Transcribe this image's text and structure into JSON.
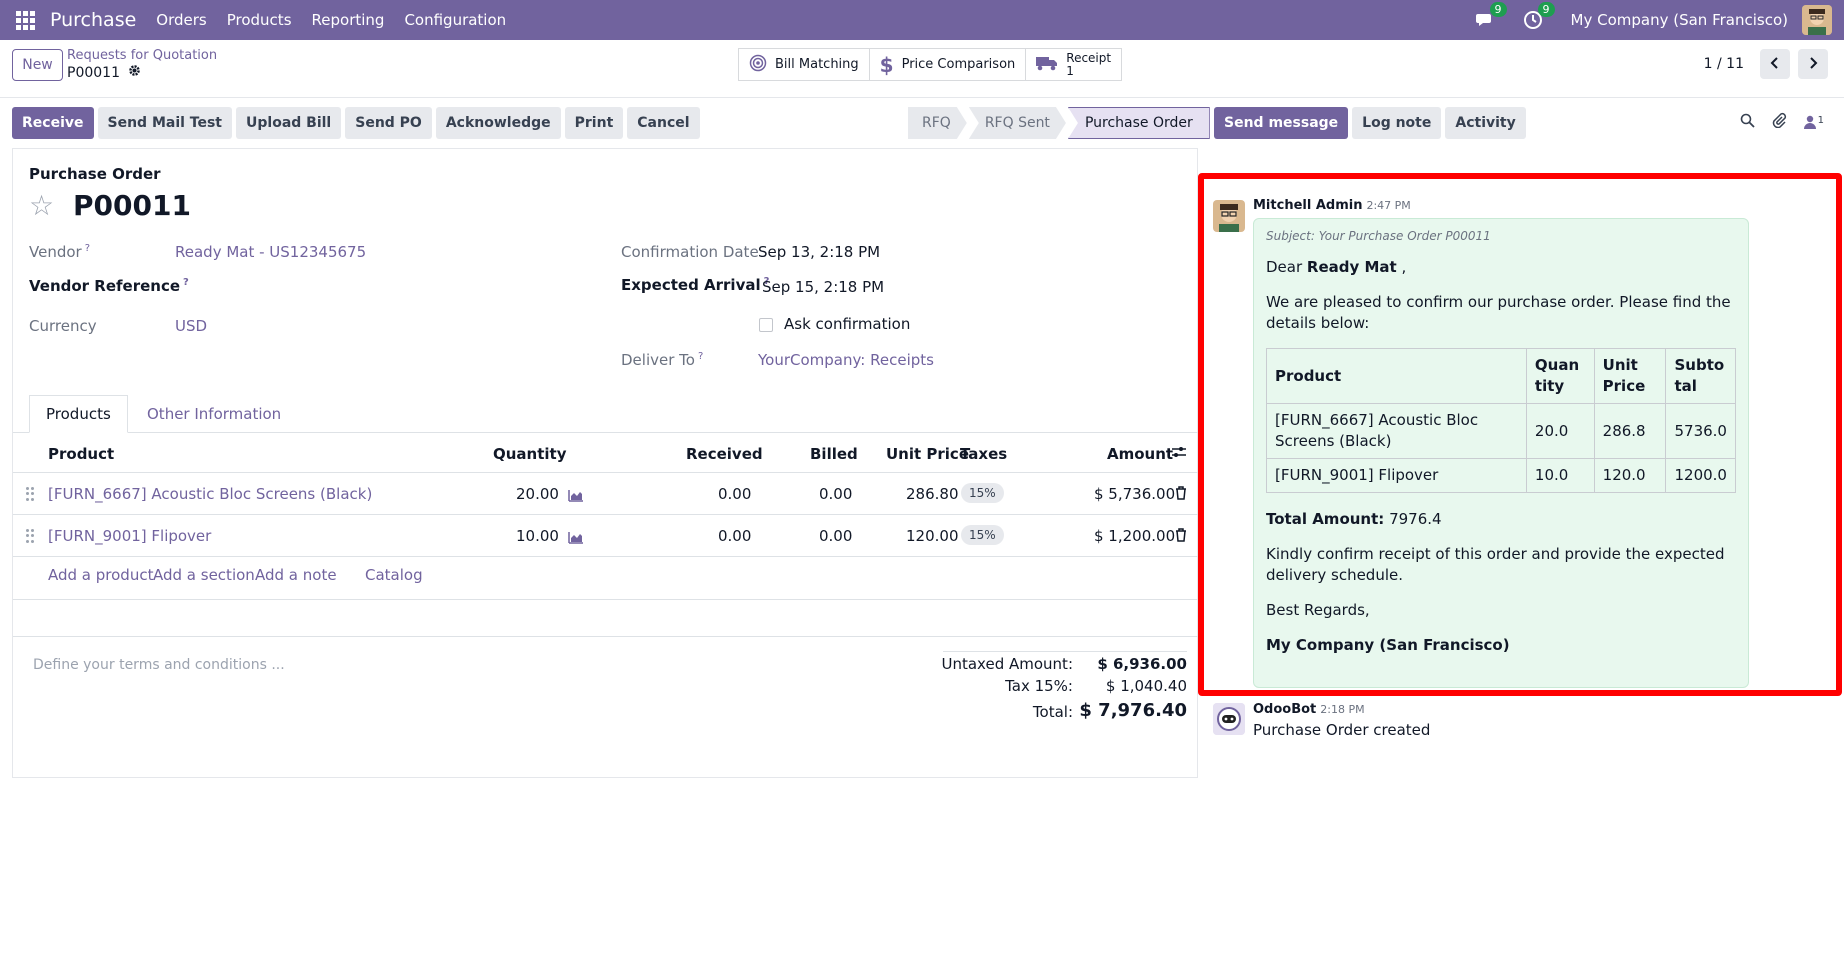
{
  "navbar": {
    "app_name": "Purchase",
    "menu": [
      "Orders",
      "Products",
      "Reporting",
      "Configuration"
    ],
    "messages_badge": "9",
    "activities_badge": "9",
    "company": "My Company (San Francisco)"
  },
  "control": {
    "new_label": "New",
    "breadcrumb_parent": "Requests for Quotation",
    "record_name": "P00011",
    "smart_buttons": {
      "bill_matching": "Bill Matching",
      "price_comparison": "Price Comparison",
      "receipt_label": "Receipt",
      "receipt_count": "1"
    },
    "pager": "1 / 11"
  },
  "actions": [
    "Receive",
    "Send Mail Test",
    "Upload Bill",
    "Send PO",
    "Acknowledge",
    "Print",
    "Cancel"
  ],
  "stages": [
    "RFQ",
    "RFQ Sent",
    "Purchase Order"
  ],
  "form": {
    "label": "Purchase Order",
    "name": "P00011",
    "vendor_label": "Vendor",
    "vendor_value": "Ready Mat - US12345675",
    "vendor_ref_label": "Vendor Reference",
    "currency_label": "Currency",
    "currency_value": "USD",
    "confirmation_label": "Confirmation Date",
    "confirmation_value": "Sep 13, 2:18 PM",
    "arrival_label": "Expected Arrival",
    "arrival_value": "Sep 15, 2:18 PM",
    "ask_confirmation": "Ask confirmation",
    "deliver_label": "Deliver To",
    "deliver_value": "YourCompany: Receipts",
    "help_mark": "?"
  },
  "tabs": [
    "Products",
    "Other Information"
  ],
  "lines": {
    "headers": {
      "product": "Product",
      "quantity": "Quantity",
      "received": "Received",
      "billed": "Billed",
      "unit_price": "Unit Price",
      "taxes": "Taxes",
      "amount": "Amount"
    },
    "rows": [
      {
        "product": "[FURN_6667] Acoustic Bloc Screens (Black)",
        "quantity": "20.00",
        "received": "0.00",
        "billed": "0.00",
        "unit_price": "286.80",
        "tax": "15%",
        "amount": "$ 5,736.00"
      },
      {
        "product": "[FURN_9001] Flipover",
        "quantity": "10.00",
        "received": "0.00",
        "billed": "0.00",
        "unit_price": "120.00",
        "tax": "15%",
        "amount": "$ 1,200.00"
      }
    ],
    "add_product": "Add a product",
    "add_section": "Add a section",
    "add_note": "Add a note",
    "catalog": "Catalog"
  },
  "terms_placeholder": "Define your terms and conditions ...",
  "totals": {
    "untaxed_label": "Untaxed Amount:",
    "untaxed_value": "$ 6,936.00",
    "tax_label": "Tax 15%:",
    "tax_value": "$ 1,040.40",
    "total_label": "Total:",
    "total_value": "$ 7,976.40"
  },
  "chatter": {
    "send_message": "Send message",
    "log_note": "Log note",
    "activity": "Activity",
    "followers_count": "1",
    "message1": {
      "author": "Mitchell Admin",
      "time": "2:47 PM",
      "subject": "Subject: Your Purchase Order P00011",
      "greeting_prefix": "Dear",
      "greeting_name": "Ready Mat",
      "greeting_suffix": ",",
      "intro": "We are pleased to confirm our purchase order. Please find the details below:",
      "table_headers": [
        "Product",
        "Quantity",
        "Unit Price",
        "Subtotal"
      ],
      "table_rows": [
        [
          "[FURN_6667] Acoustic Bloc Screens (Black)",
          "20.0",
          "286.8",
          "5736.0"
        ],
        [
          "[FURN_9001] Flipover",
          "10.0",
          "120.0",
          "1200.0"
        ]
      ],
      "total_label": "Total Amount:",
      "total_value": "7976.4",
      "closing": "Kindly confirm receipt of this order and provide the expected delivery schedule.",
      "regards": "Best Regards,",
      "signature": "My Company (San Francisco)"
    },
    "message2": {
      "author": "OdooBot",
      "time": "2:18 PM",
      "text": "Purchase Order created"
    }
  },
  "colors": {
    "brand": "#71639e",
    "highlight": "#ff0000",
    "badge": "#1e9e50",
    "bubble": "#e8f8ee"
  }
}
